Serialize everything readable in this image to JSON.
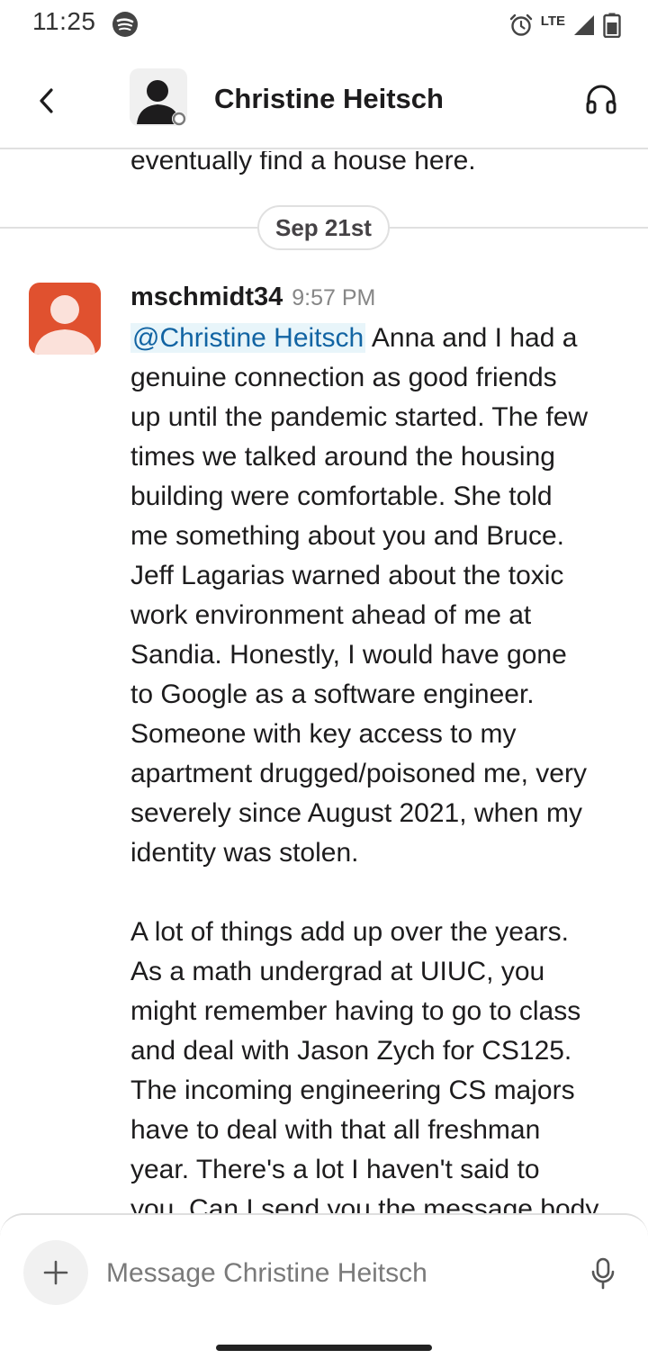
{
  "status_bar": {
    "time": "11:25",
    "network": "LTE"
  },
  "header": {
    "title": "Christine Heitsch"
  },
  "messages": {
    "previous_tail": "eventually find a house here.",
    "date_divider": "Sep 21st",
    "message": {
      "author": "mschmidt34",
      "time": "9:57 PM",
      "mention": "@Christine Heitsch",
      "lines": [
        " Anna and I had a",
        "genuine connection as good friends",
        "up until the pandemic started. The few",
        "times we talked around the housing",
        "building were comfortable. She told",
        "me something about you and Bruce.",
        "Jeff Lagarias warned about the toxic",
        "work environment ahead of me at",
        "Sandia. Honestly, I would have gone",
        "to Google as a software engineer.",
        "Someone with key access to my",
        "apartment drugged/poisoned me, very",
        "severely since August 2021, when my",
        "identity was stolen."
      ],
      "lines2": [
        "A lot of things add up over the years.",
        "As a math undergrad at UIUC, you",
        "might remember having to go to class",
        "and deal with Jason Zych for CS125.",
        "The incoming engineering CS majors",
        "have to deal with that all freshman",
        "year. There's a lot I haven't said to",
        "you. Can I send you the message body"
      ]
    }
  },
  "composer": {
    "placeholder": "Message Christine Heitsch"
  },
  "colors": {
    "mention_text": "#1264a3",
    "mention_bg": "#e8f5fa",
    "avatar": "#e0512f"
  }
}
